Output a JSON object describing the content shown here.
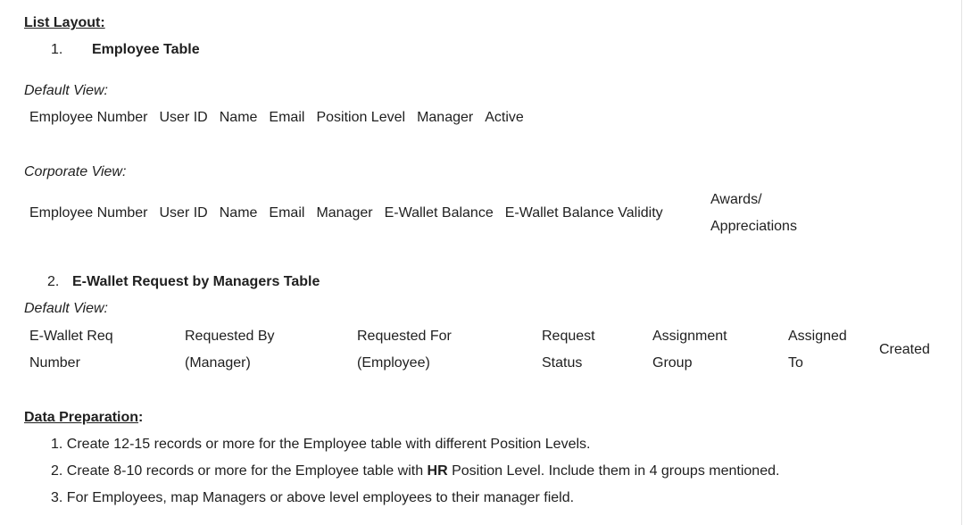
{
  "list_layout": {
    "heading": "List Layout:",
    "item1_number": "1.",
    "item1_title": "Employee Table",
    "default_view_label": "Default View:",
    "default_columns": [
      "Employee Number",
      "User ID",
      "Name",
      "Email",
      "Position Level",
      "Manager",
      "Active"
    ],
    "corporate_view_label": "Corporate View:",
    "corporate_columns": [
      "Employee Number",
      "User ID",
      "Name",
      "Email",
      "Manager",
      "E-Wallet Balance",
      "E-Wallet Balance Validity"
    ],
    "corporate_last_col": [
      "Awards/",
      "Appreciations"
    ],
    "item2_number": "2.",
    "item2_title": "E-Wallet Request by Managers Table",
    "default_view_label2": "Default View:",
    "ewallet_columns": [
      [
        "E-Wallet Req",
        "Number"
      ],
      [
        "Requested By",
        "(Manager)"
      ],
      [
        "Requested For",
        "(Employee)"
      ],
      [
        "Request",
        "Status"
      ],
      [
        "Assignment",
        "Group"
      ],
      [
        "Assigned",
        "To"
      ],
      [
        "Created"
      ]
    ]
  },
  "data_preparation": {
    "heading": "Data Preparation",
    "colon": ":",
    "items": [
      {
        "num": "1.",
        "text": "Create 12-15 records or more for the Employee table with different Position Levels."
      },
      {
        "num": "2.",
        "pre": "Create 8-10 records or more for the Employee table with ",
        "bold": "HR",
        "post": " Position Level. Include them in 4 groups mentioned."
      },
      {
        "num": "3.",
        "text": "For Employees, map Managers or above level employees to their manager field."
      }
    ]
  }
}
